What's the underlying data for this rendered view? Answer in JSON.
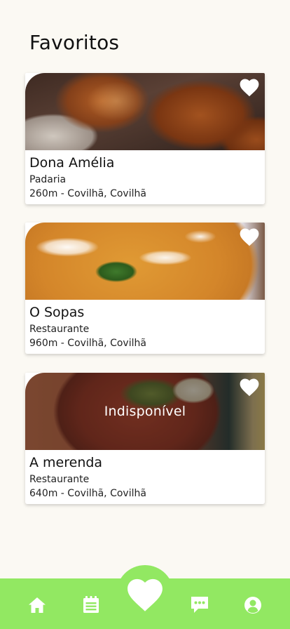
{
  "page": {
    "title": "Favoritos"
  },
  "favorites": [
    {
      "name": "Dona Amélia",
      "category": "Padaria",
      "location": "260m - Covilhã, Covilhã",
      "image": "bread-photo",
      "favorited": true,
      "unavailable": false
    },
    {
      "name": "O Sopas",
      "category": "Restaurante",
      "location": "960m - Covilhã, Covilhã",
      "image": "soup-photo",
      "favorited": true,
      "unavailable": false
    },
    {
      "name": "A merenda",
      "category": "Restaurante",
      "location": "640m - Covilhã, Covilhã",
      "image": "stew-photo",
      "favorited": true,
      "unavailable": true,
      "unavailable_label": "Indisponível"
    }
  ],
  "bottom_nav": {
    "background": "#92e862",
    "items": [
      {
        "icon": "home-icon",
        "active": false
      },
      {
        "icon": "list-icon",
        "active": false
      },
      {
        "icon": "heart-icon",
        "active": true
      },
      {
        "icon": "chat-icon",
        "active": false
      },
      {
        "icon": "user-icon",
        "active": false
      }
    ]
  }
}
